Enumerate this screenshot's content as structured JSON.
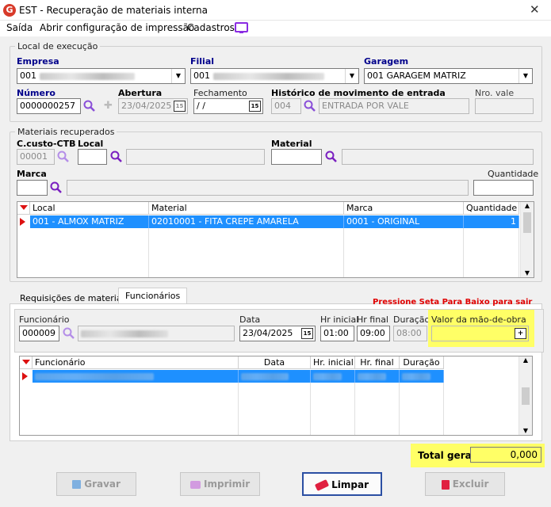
{
  "window": {
    "title": "EST - Recuperação de materiais interna",
    "close": "✕"
  },
  "menu": {
    "items": [
      "Saída",
      "Abrir configuração de impressão",
      "Cadastros"
    ]
  },
  "local_execucao": {
    "legend": "Local de execução",
    "empresa_label": "Empresa",
    "empresa_value": "001",
    "filial_label": "Filial",
    "filial_value": "001",
    "garagem_label": "Garagem",
    "garagem_value": "001 GARAGEM MATRIZ",
    "numero_label": "Número",
    "numero_value": "0000000257",
    "abertura_label": "Abertura",
    "abertura_value": "23/04/2025",
    "fechamento_label": "Fechamento",
    "fechamento_value": " /  /",
    "historico_label": "Histórico de movimento de entrada",
    "historico_code": "004",
    "historico_desc": "ENTRADA POR VALE",
    "nro_vale_label": "Nro. vale",
    "nro_vale_value": ""
  },
  "materiais": {
    "legend": "Materiais recuperados",
    "ccusto_label": "C.custo-CTB",
    "ccusto_value": "00001",
    "local_label": "Local",
    "local_value": "",
    "material_label": "Material",
    "material_value": "",
    "marca_label": "Marca",
    "marca_value": "",
    "quantidade_label": "Quantidade",
    "quantidade_value": "",
    "grid": {
      "columns": [
        "Local",
        "Material",
        "Marca",
        "Quantidade"
      ],
      "rows": [
        [
          "001 - ALMOX MATRIZ",
          "02010001 - FITA CREPE AMARELA",
          "0001 - ORIGINAL",
          "1"
        ]
      ]
    }
  },
  "tabs": {
    "items": [
      "Requisições de material",
      "Funcionários"
    ],
    "active": "Funcionários"
  },
  "funcionarios": {
    "hint": "Pressione Seta Para Baixo para sair",
    "func_label": "Funcionário",
    "func_value": "000009",
    "data_label": "Data",
    "data_value": "23/04/2025",
    "hr_inicial_label": "Hr inicial",
    "hr_inicial_value": "01:00",
    "hr_final_label": "Hr final",
    "hr_final_value": "09:00",
    "duracao_label": "Duração",
    "duracao_value": "08:00",
    "valor_label": "Valor da mão-de-obra",
    "valor_value": "",
    "grid": {
      "columns": [
        "Funcionário",
        "Data",
        "Hr. inicial",
        "Hr. final",
        "Duração"
      ]
    }
  },
  "total": {
    "label": "Total geral",
    "value": "0,000"
  },
  "buttons": {
    "gravar": "Gravar",
    "imprimir": "Imprimir",
    "limpar": "Limpar",
    "excluir": "Excluir"
  },
  "colors": {
    "highlight": "#ffff66",
    "hint": "#e00000",
    "selected_row": "#1e90ff"
  }
}
